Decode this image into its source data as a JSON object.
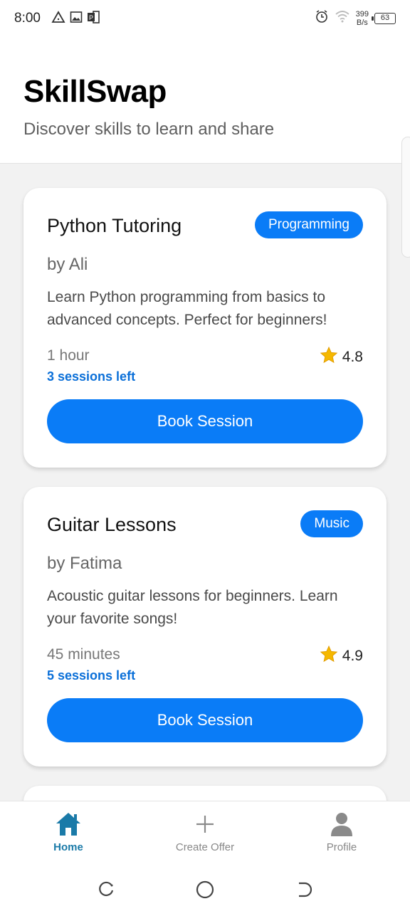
{
  "status_bar": {
    "time": "8:00",
    "net_speed_value": "399",
    "net_speed_unit": "B/s",
    "battery": "63"
  },
  "header": {
    "title": "SkillSwap",
    "subtitle": "Discover skills to learn and share"
  },
  "cards": [
    {
      "title": "Python Tutoring",
      "category": "Programming",
      "author": "by Ali",
      "description": "Learn Python programming from basics to advanced concepts. Perfect for beginners!",
      "duration": "1 hour",
      "rating": "4.8",
      "sessions_left": "3 sessions left",
      "button_label": "Book Session"
    },
    {
      "title": "Guitar Lessons",
      "category": "Music",
      "author": "by Fatima",
      "description": "Acoustic guitar lessons for beginners. Learn your favorite songs!",
      "duration": "45 minutes",
      "rating": "4.9",
      "sessions_left": "5 sessions left",
      "button_label": "Book Session"
    }
  ],
  "bottom_nav": {
    "items": [
      {
        "label": "Home",
        "icon": "home-icon",
        "active": true
      },
      {
        "label": "Create Offer",
        "icon": "plus-icon",
        "active": false
      },
      {
        "label": "Profile",
        "icon": "person-icon",
        "active": false
      }
    ]
  },
  "colors": {
    "accent": "#0a7cf7",
    "nav_active": "#1a7aa8",
    "star": "#f5b800"
  }
}
